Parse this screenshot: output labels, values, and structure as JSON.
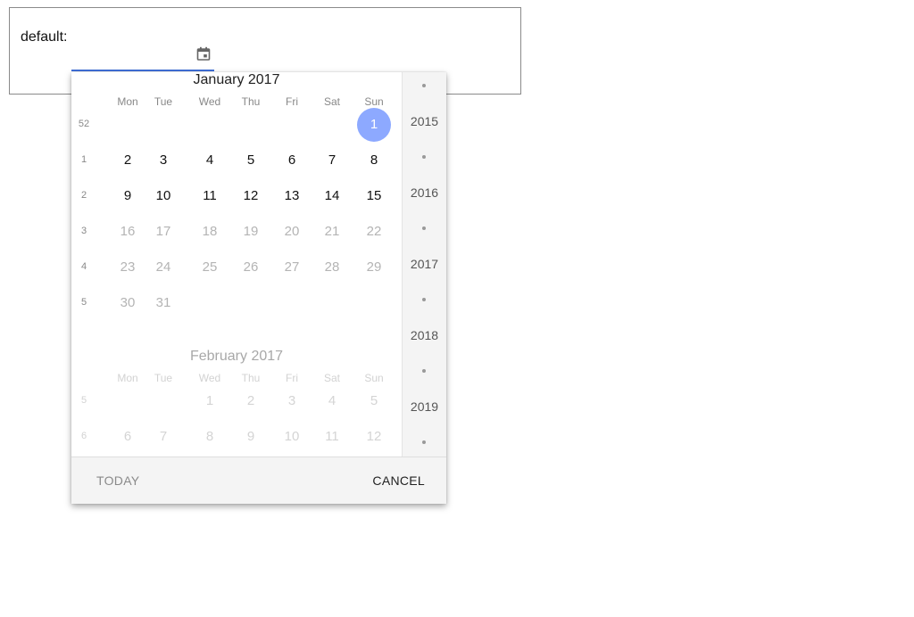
{
  "field": {
    "label": "default:"
  },
  "calendar": {
    "weekdays": [
      "Mon",
      "Tue",
      "Wed",
      "Thu",
      "Fri",
      "Sat",
      "Sun"
    ],
    "months": [
      {
        "title": "January 2017",
        "faded": false,
        "weeks": [
          {
            "num": "52",
            "days": [
              "",
              "",
              "",
              "",
              "",
              "",
              "1"
            ]
          },
          {
            "num": "1",
            "days": [
              "2",
              "3",
              "4",
              "5",
              "6",
              "7",
              "8"
            ]
          },
          {
            "num": "2",
            "days": [
              "9",
              "10",
              "11",
              "12",
              "13",
              "14",
              "15"
            ]
          },
          {
            "num": "3",
            "days": [
              "16",
              "17",
              "18",
              "19",
              "20",
              "21",
              "22"
            ]
          },
          {
            "num": "4",
            "days": [
              "23",
              "24",
              "25",
              "26",
              "27",
              "28",
              "29"
            ]
          },
          {
            "num": "5",
            "days": [
              "30",
              "31",
              "",
              "",
              "",
              "",
              ""
            ]
          }
        ],
        "selected_day": "1",
        "muted_from_day": 16
      },
      {
        "title": "February 2017",
        "faded": true,
        "weeks": [
          {
            "num": "5",
            "days": [
              "",
              "",
              "1",
              "2",
              "3",
              "4",
              "5"
            ]
          },
          {
            "num": "6",
            "days": [
              "6",
              "7",
              "8",
              "9",
              "10",
              "11",
              "12"
            ]
          }
        ]
      }
    ]
  },
  "years": [
    "2015",
    "2016",
    "2017",
    "2018",
    "2019"
  ],
  "footer": {
    "today_label": "TODAY",
    "cancel_label": "CANCEL"
  },
  "colors": {
    "accent": "#3f6fd8",
    "selected": "#8da9ff"
  },
  "icons": {
    "calendar": "calendar-icon"
  }
}
